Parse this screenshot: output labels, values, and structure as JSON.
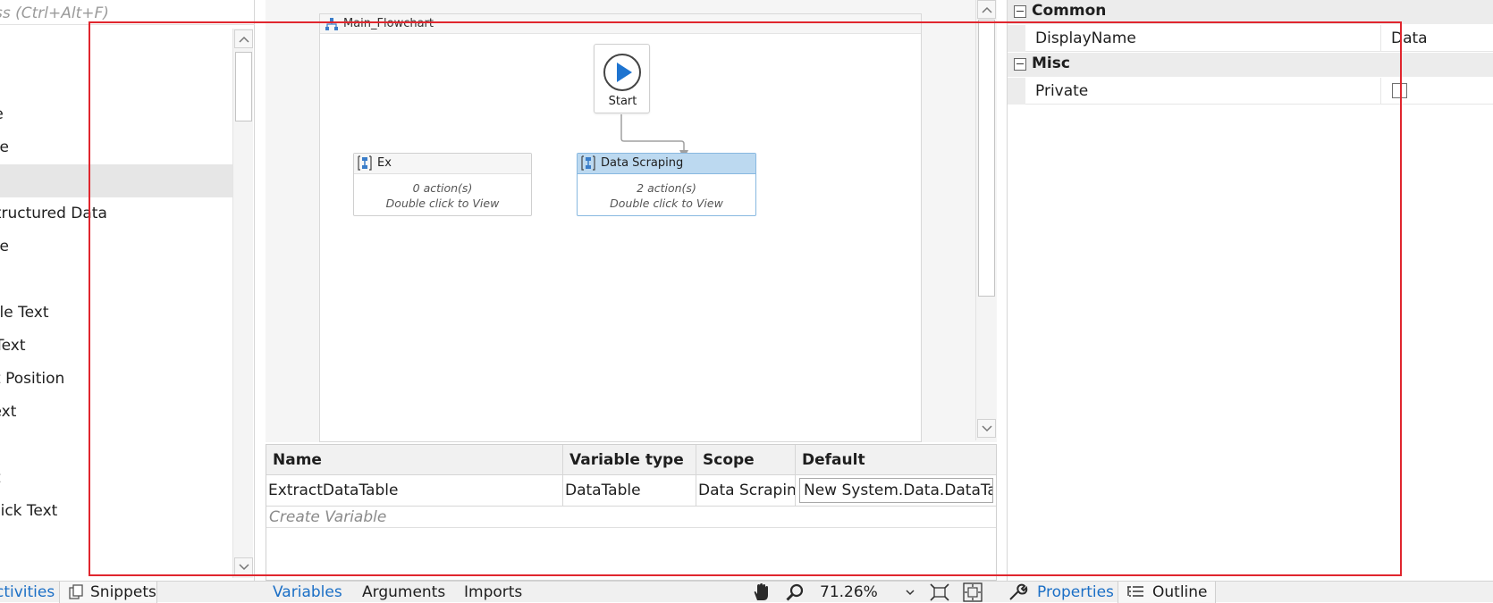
{
  "activities_panel": {
    "search_hint": "ss (Ctrl+Alt+F)",
    "items": [
      "ce",
      "ine",
      "",
      "Structured Data",
      "ine",
      "",
      "ible Text",
      "l Text",
      "xt Position",
      "Text",
      "",
      "xt",
      " Click Text"
    ],
    "selected_index": 2
  },
  "designer": {
    "flowchart_title": "Main_Flowchart",
    "start_label": "Start",
    "nodes": [
      {
        "title": "Ex",
        "actions": "0 action(s)",
        "hint": "Double click to View"
      },
      {
        "title": "Data Scraping",
        "actions": "2 action(s)",
        "hint": "Double click to View"
      }
    ]
  },
  "variables": {
    "headers": [
      "Name",
      "Variable type",
      "Scope",
      "Default"
    ],
    "rows": [
      {
        "name": "ExtractDataTable",
        "type": "DataTable",
        "scope": "Data Scraping",
        "default": "New System.Data.DataTa"
      }
    ],
    "create_hint": "Create Variable"
  },
  "bottom_tabs": {
    "activities": "ctivities",
    "snippets": "Snippets",
    "variables": "Variables",
    "arguments": "Arguments",
    "imports": "Imports",
    "zoom": "71.26%",
    "properties": "Properties",
    "outline": "Outline"
  },
  "properties": {
    "categories": [
      {
        "name": "Common",
        "rows": [
          {
            "name": "DisplayName",
            "value": "Data Scraping"
          }
        ]
      },
      {
        "name": "Misc",
        "rows": [
          {
            "name": "Private",
            "value": ""
          }
        ]
      }
    ],
    "private_checked": false
  },
  "colors": {
    "accent_blue": "#1b6fc6",
    "selected_node_header": "#bcd9f0",
    "highlight_red": "#e0262e",
    "start_play": "#1e74d0"
  }
}
